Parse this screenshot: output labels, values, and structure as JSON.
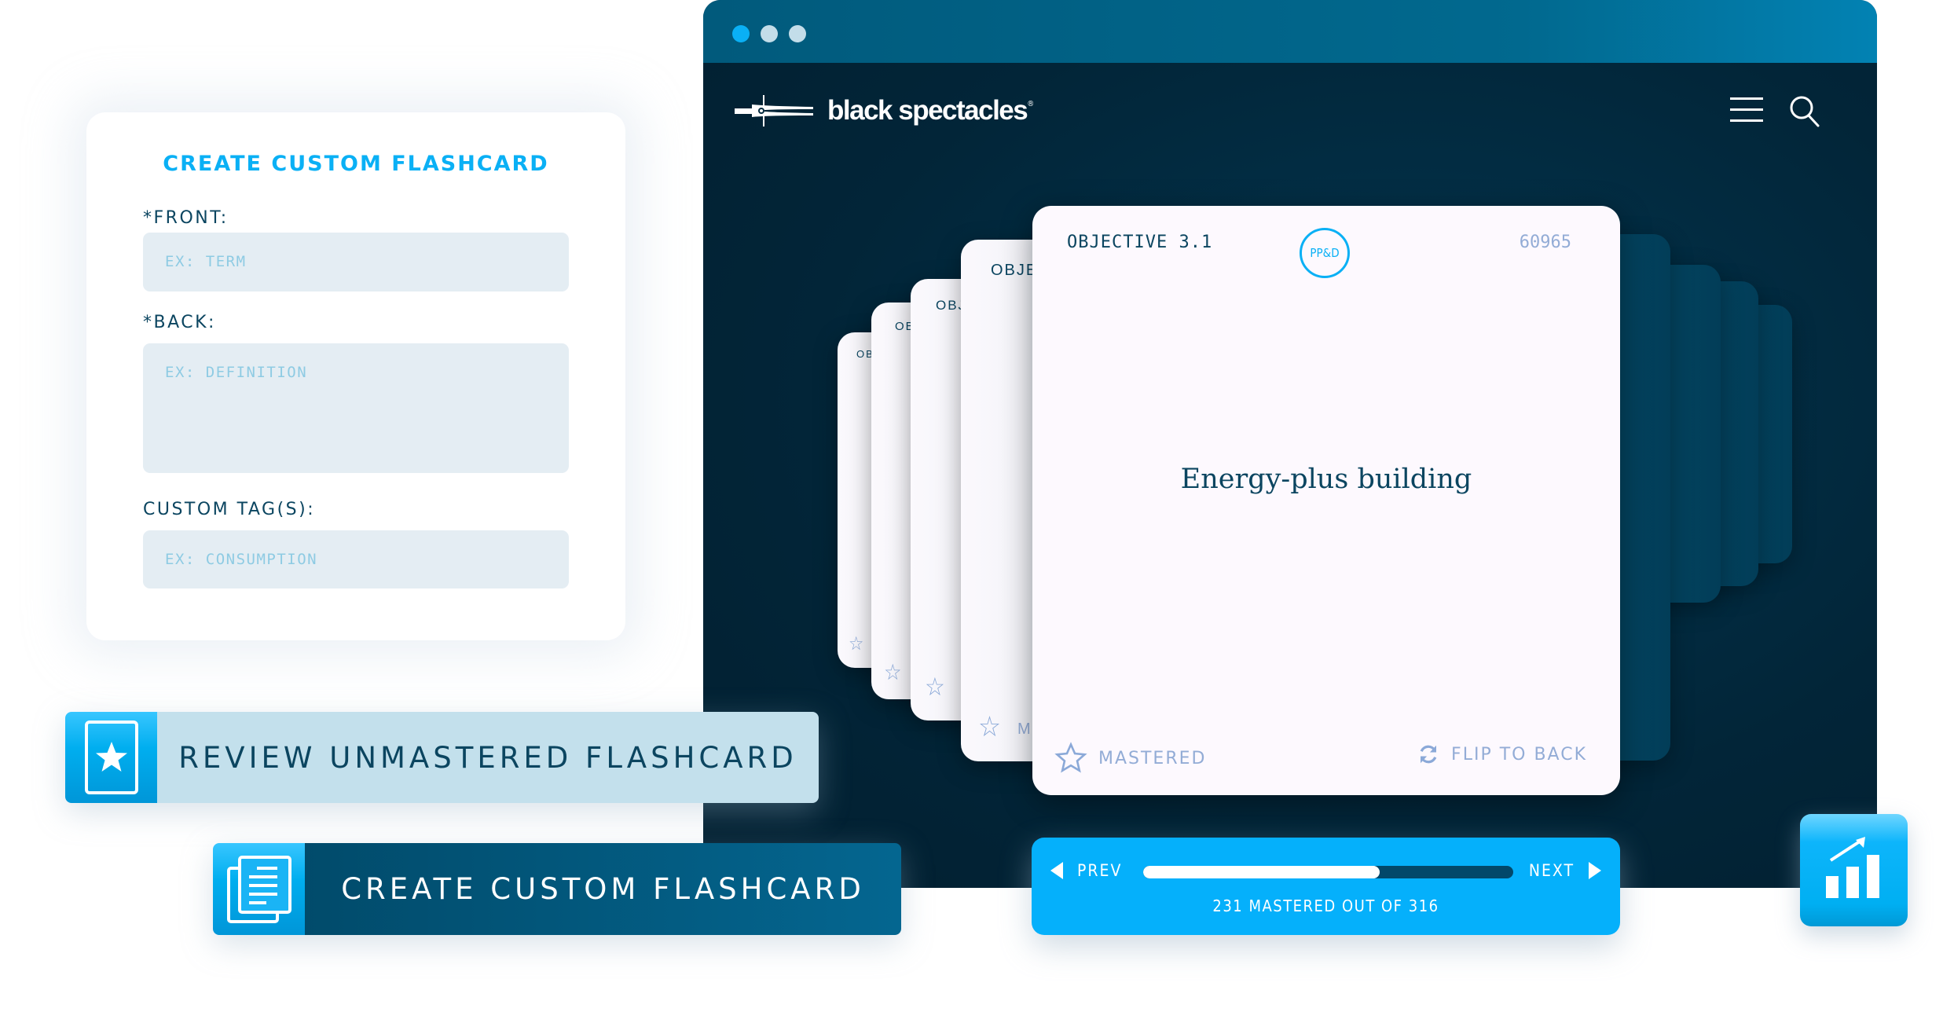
{
  "form": {
    "title": "CREATE CUSTOM FLASHCARD",
    "front_label": "*FRONT:",
    "front_placeholder": "EX: TERM",
    "back_label": "*BACK:",
    "back_placeholder": "EX: DEFINITION",
    "tags_label": "CUSTOM TAG(S):",
    "tags_placeholder": "EX: CONSUMPTION"
  },
  "actions": {
    "review_label": "REVIEW UNMASTERED FLASHCARD",
    "review_icon": "star-card-icon",
    "create_label": "CREATE CUSTOM FLASHCARD",
    "create_icon": "document-stack-icon"
  },
  "browser": {
    "dots": [
      "#0ab0f5",
      "#c3dde9",
      "#c3dde9"
    ],
    "brand": "black spectacles",
    "brand_mark": "®",
    "menu_icon": "hamburger-icon",
    "search_icon": "search-icon"
  },
  "stack_back_cards": [
    {
      "label": "OB"
    },
    {
      "label": "OB"
    },
    {
      "label": "OBJ"
    },
    {
      "label": "OBJE",
      "footer": "M"
    }
  ],
  "card": {
    "objective": "OBJECTIVE 3.1",
    "badge": "PP&D",
    "id": "60965",
    "term": "Energy-plus building",
    "mastered_label": "MASTERED",
    "flip_label": "FLIP TO BACK"
  },
  "nav": {
    "prev_label": "PREV",
    "next_label": "NEXT",
    "progress": 0.64,
    "status": "231 MASTERED OUT OF 316"
  },
  "stats_icon": "bar-chart-growth-icon",
  "colors": {
    "accent": "#05b0fb",
    "navy": "#0b4560",
    "dark_bg": "#022538"
  }
}
